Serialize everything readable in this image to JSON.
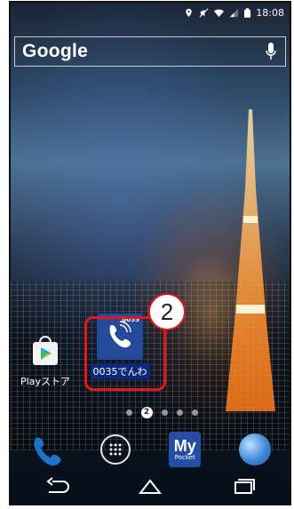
{
  "statusbar": {
    "time": "18:08",
    "icons": [
      "location-icon",
      "no-sound-icon",
      "wifi-icon",
      "signal-icon",
      "battery-icon"
    ]
  },
  "search": {
    "brand": "Google",
    "mic_icon": "microphone-icon"
  },
  "apps": [
    {
      "label": "Playストア",
      "icon": "google-play-icon"
    },
    {
      "label": "0035でんわ",
      "icon": "phone-app-icon",
      "badge_text": "0035"
    }
  ],
  "annotation": {
    "step_number": "2",
    "highlight_color": "#e2161b"
  },
  "pager": {
    "active_page": "2",
    "dot_count": 5
  },
  "dock": [
    {
      "name": "phone",
      "icon": "phone-icon"
    },
    {
      "name": "all-apps",
      "icon": "apps-grid-icon"
    },
    {
      "name": "my-pocket",
      "line1": "My",
      "line2": "Pocket",
      "icon": "mypocket-icon"
    },
    {
      "name": "browser",
      "icon": "globe-icon"
    }
  ],
  "navbar": {
    "back_icon": "back-icon",
    "home_icon": "home-icon",
    "recents_icon": "recents-icon"
  }
}
